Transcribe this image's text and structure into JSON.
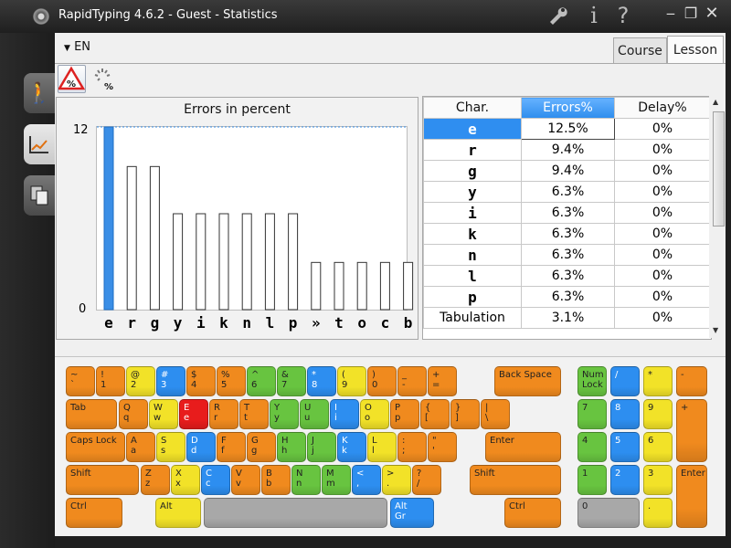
{
  "window": {
    "title": "RapidTyping 4.6.2 - Guest - Statistics",
    "wrench_icon": "wrench-icon",
    "info_icon": "info-icon",
    "help_icon": "help-icon",
    "min_icon": "minimize-icon",
    "restore_icon": "restore-icon",
    "close_icon": "close-icon"
  },
  "sidebar": {
    "items": [
      {
        "name": "walk-icon"
      },
      {
        "name": "stats-chart-icon"
      },
      {
        "name": "lessons-icon"
      }
    ]
  },
  "toolbar": {
    "language": "EN",
    "error_toggle_label": "%",
    "delay_toggle_label": "%"
  },
  "tabs": [
    {
      "label": "Course"
    },
    {
      "label": "Lesson"
    }
  ],
  "chart_data": {
    "type": "bar",
    "title": "Errors in percent",
    "categories": [
      "e",
      "r",
      "g",
      "y",
      "i",
      "k",
      "n",
      "l",
      "p",
      "»",
      "t",
      "o",
      "c",
      "b"
    ],
    "values": [
      12.5,
      9.4,
      9.4,
      6.3,
      6.3,
      6.3,
      6.3,
      6.3,
      6.3,
      3.1,
      3.1,
      3.1,
      3.1,
      3.1
    ],
    "ylim": [
      0,
      12
    ],
    "ytick_labels": [
      "12",
      "0"
    ],
    "highlight_index": 0,
    "colors": {
      "highlight": "#3a8ee6",
      "bar": "#ffffff"
    }
  },
  "grid": {
    "columns": [
      "Char.",
      "Errors%",
      "Delay%"
    ],
    "rows": [
      {
        "char": "e",
        "errors": "12.5%",
        "delay": "0%"
      },
      {
        "char": "r",
        "errors": "9.4%",
        "delay": "0%"
      },
      {
        "char": "g",
        "errors": "9.4%",
        "delay": "0%"
      },
      {
        "char": "y",
        "errors": "6.3%",
        "delay": "0%"
      },
      {
        "char": "i",
        "errors": "6.3%",
        "delay": "0%"
      },
      {
        "char": "k",
        "errors": "6.3%",
        "delay": "0%"
      },
      {
        "char": "n",
        "errors": "6.3%",
        "delay": "0%"
      },
      {
        "char": "l",
        "errors": "6.3%",
        "delay": "0%"
      },
      {
        "char": "p",
        "errors": "6.3%",
        "delay": "0%"
      },
      {
        "char": "Tabulation",
        "errors": "3.1%",
        "delay": "0%"
      }
    ]
  },
  "colors": {
    "O": "#f08a1e",
    "Y": "#f2e228",
    "B": "#2d8ef0",
    "G": "#68c440",
    "R": "#e81c1c",
    "Gr": "#a8a8a8"
  },
  "keyboard": {
    "row1": [
      {
        "t": "~",
        "b": "`",
        "c": "O"
      },
      {
        "t": "!",
        "b": "1",
        "c": "O"
      },
      {
        "t": "@",
        "b": "2",
        "c": "Y"
      },
      {
        "t": "#",
        "b": "3",
        "c": "B"
      },
      {
        "t": "$",
        "b": "4",
        "c": "O"
      },
      {
        "t": "%",
        "b": "5",
        "c": "O"
      },
      {
        "t": "^",
        "b": "6",
        "c": "G"
      },
      {
        "t": "&",
        "b": "7",
        "c": "G"
      },
      {
        "t": "*",
        "b": "8",
        "c": "B"
      },
      {
        "t": "(",
        "b": "9",
        "c": "Y"
      },
      {
        "t": ")",
        "b": "0",
        "c": "O"
      },
      {
        "t": "_",
        "b": "-",
        "c": "O"
      },
      {
        "t": "+",
        "b": "=",
        "c": "O"
      },
      {
        "t": "Back Space",
        "b": "",
        "c": "O"
      }
    ],
    "row2": [
      {
        "t": "Tab",
        "b": "",
        "c": "O"
      },
      {
        "t": "Q",
        "b": "q",
        "c": "O"
      },
      {
        "t": "W",
        "b": "w",
        "c": "Y"
      },
      {
        "t": "E",
        "b": "e",
        "c": "R"
      },
      {
        "t": "R",
        "b": "r",
        "c": "O"
      },
      {
        "t": "T",
        "b": "t",
        "c": "O"
      },
      {
        "t": "Y",
        "b": "y",
        "c": "G"
      },
      {
        "t": "U",
        "b": "u",
        "c": "G"
      },
      {
        "t": "I",
        "b": "i",
        "c": "B"
      },
      {
        "t": "O",
        "b": "o",
        "c": "Y"
      },
      {
        "t": "P",
        "b": "p",
        "c": "O"
      },
      {
        "t": "{",
        "b": "[",
        "c": "O"
      },
      {
        "t": "}",
        "b": "]",
        "c": "O"
      },
      {
        "t": "|",
        "b": "\\",
        "c": "O"
      }
    ],
    "row3": [
      {
        "t": "Caps Lock",
        "b": "",
        "c": "O"
      },
      {
        "t": "A",
        "b": "a",
        "c": "O"
      },
      {
        "t": "S",
        "b": "s",
        "c": "Y"
      },
      {
        "t": "D",
        "b": "d",
        "c": "B"
      },
      {
        "t": "F",
        "b": "f",
        "c": "O"
      },
      {
        "t": "G",
        "b": "g",
        "c": "O"
      },
      {
        "t": "H",
        "b": "h",
        "c": "G"
      },
      {
        "t": "J",
        "b": "j",
        "c": "G"
      },
      {
        "t": "K",
        "b": "k",
        "c": "B"
      },
      {
        "t": "L",
        "b": "l",
        "c": "Y"
      },
      {
        "t": ":",
        "b": ";",
        "c": "O"
      },
      {
        "t": "\"",
        "b": "'",
        "c": "O"
      },
      {
        "t": "Enter",
        "b": "",
        "c": "O"
      }
    ],
    "row4": [
      {
        "t": "Shift",
        "b": "",
        "c": "O"
      },
      {
        "t": "Z",
        "b": "z",
        "c": "O"
      },
      {
        "t": "X",
        "b": "x",
        "c": "Y"
      },
      {
        "t": "C",
        "b": "c",
        "c": "B"
      },
      {
        "t": "V",
        "b": "v",
        "c": "O"
      },
      {
        "t": "B",
        "b": "b",
        "c": "O"
      },
      {
        "t": "N",
        "b": "n",
        "c": "G"
      },
      {
        "t": "M",
        "b": "m",
        "c": "G"
      },
      {
        "t": "<",
        "b": ",",
        "c": "B"
      },
      {
        "t": ">",
        "b": ".",
        "c": "Y"
      },
      {
        "t": "?",
        "b": "/",
        "c": "O"
      },
      {
        "t": "Shift",
        "b": "",
        "c": "O"
      }
    ],
    "row5": [
      {
        "t": "Ctrl",
        "b": "",
        "c": "O"
      },
      {
        "t": "Alt",
        "b": "",
        "c": "Y"
      },
      {
        "t": "",
        "b": "",
        "c": "Gr"
      },
      {
        "t": "Alt",
        "b": "Gr",
        "c": "B"
      },
      {
        "t": "Ctrl",
        "b": "",
        "c": "O"
      }
    ],
    "numpad": [
      {
        "t": "Num",
        "b": "Lock",
        "c": "G"
      },
      {
        "t": "/",
        "b": "",
        "c": "B"
      },
      {
        "t": "*",
        "b": "",
        "c": "Y"
      },
      {
        "t": "-",
        "b": "",
        "c": "O"
      },
      {
        "t": "7",
        "b": "",
        "c": "G"
      },
      {
        "t": "8",
        "b": "",
        "c": "B"
      },
      {
        "t": "9",
        "b": "",
        "c": "Y"
      },
      {
        "t": "+",
        "b": "",
        "c": "O"
      },
      {
        "t": "4",
        "b": "",
        "c": "G"
      },
      {
        "t": "5",
        "b": "",
        "c": "B"
      },
      {
        "t": "6",
        "b": "",
        "c": "Y"
      },
      {
        "t": "1",
        "b": "",
        "c": "G"
      },
      {
        "t": "2",
        "b": "",
        "c": "B"
      },
      {
        "t": "3",
        "b": "",
        "c": "Y"
      },
      {
        "t": "Enter",
        "b": "",
        "c": "O"
      },
      {
        "t": "0",
        "b": "",
        "c": "Gr"
      },
      {
        "t": ".",
        "b": "",
        "c": "Y"
      }
    ]
  }
}
